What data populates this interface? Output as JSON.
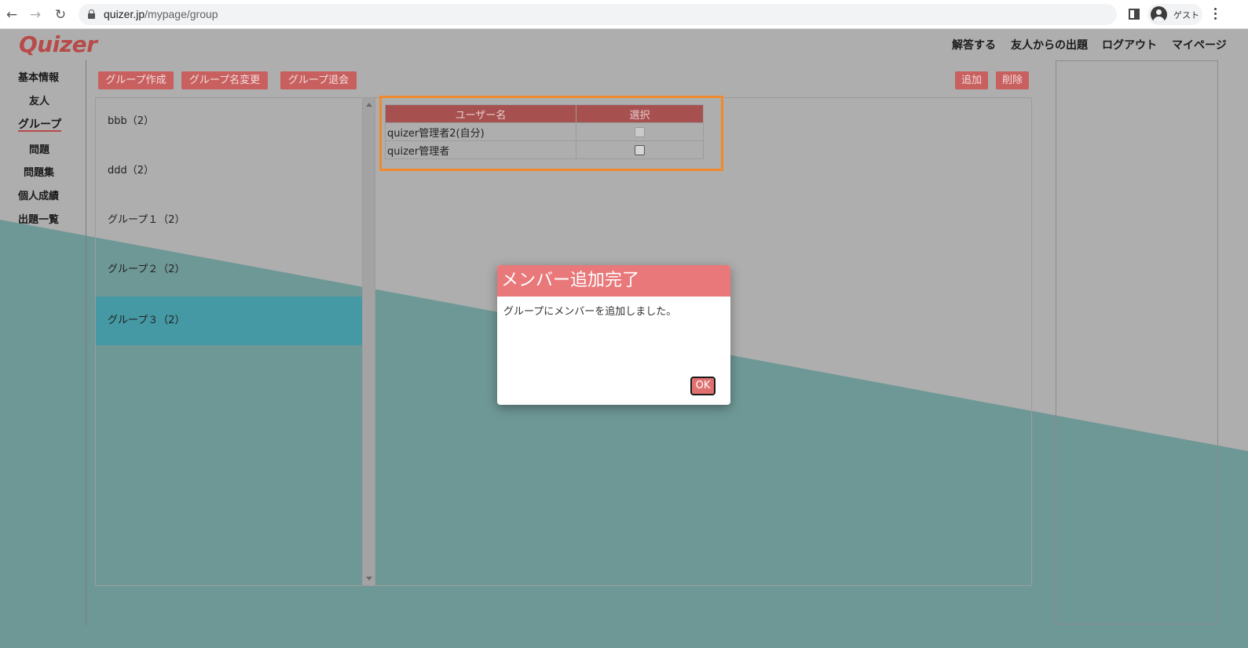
{
  "browser": {
    "url_host": "quizer.jp",
    "url_path": "/mypage/group",
    "profile_label": "ゲスト",
    "icons": [
      "back-arrow-icon",
      "forward-arrow-icon",
      "reload-icon",
      "lock-icon",
      "side-panel-icon",
      "avatar-icon",
      "kebab-menu-icon"
    ]
  },
  "header": {
    "logo": "Quizer",
    "nav": [
      "解答する",
      "友人からの出題",
      "ログアウト",
      "マイページ"
    ]
  },
  "sidebar": {
    "items": [
      "基本情報",
      "友人",
      "グループ",
      "問題",
      "問題集",
      "個人成績",
      "出題一覧"
    ],
    "active": "グループ"
  },
  "toolbar": {
    "create_group": "グループ作成",
    "rename_group": "グループ名変更",
    "leave_group": "グループ退会",
    "add": "追加",
    "delete": "削除"
  },
  "groups": [
    {
      "label": "bbb（2）"
    },
    {
      "label": "ddd（2）"
    },
    {
      "label": "グループ１（2）"
    },
    {
      "label": "グループ２（2）"
    },
    {
      "label": "グループ３（2）",
      "selected": true
    }
  ],
  "member_table": {
    "headers": [
      "ユーザー名",
      "選択"
    ],
    "rows": [
      {
        "name": "quizer管理者2(自分)",
        "checkbox_disabled": true
      },
      {
        "name": "quizer管理者",
        "checkbox_disabled": false
      }
    ]
  },
  "modal": {
    "title": "メンバー追加完了",
    "message": "グループにメンバーを追加しました。",
    "ok_label": "OK"
  },
  "colors": {
    "accent": "#c8605f",
    "table_header": "#a75050",
    "selected_group": "#4499a4",
    "highlight_border": "#f08a2c",
    "modal_header": "#e8787a",
    "background_gray": "#aeaeae",
    "background_teal": "#6e9896"
  }
}
